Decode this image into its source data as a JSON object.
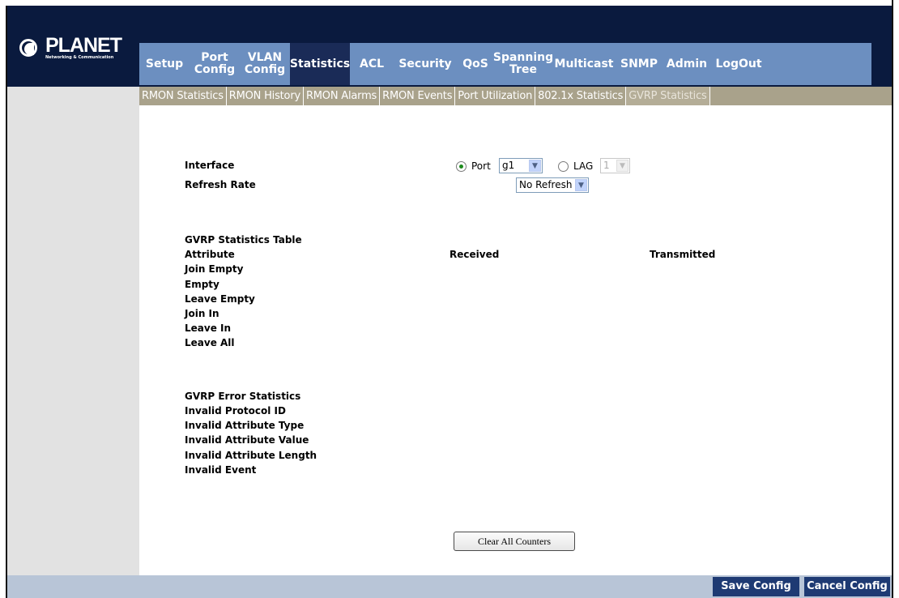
{
  "brand": {
    "logo_text": "PLANET",
    "logo_sub": "Networking & Communication"
  },
  "nav": [
    {
      "label": "Setup"
    },
    {
      "label": "Port Config"
    },
    {
      "label": "VLAN Config"
    },
    {
      "label": "Statistics",
      "active": true
    },
    {
      "label": "ACL"
    },
    {
      "label": "Security"
    },
    {
      "label": "QoS"
    },
    {
      "label": "Spanning Tree"
    },
    {
      "label": "Multicast"
    },
    {
      "label": "SNMP"
    },
    {
      "label": "Admin"
    },
    {
      "label": "LogOut"
    }
  ],
  "subnav": [
    {
      "label": "RMON Statistics"
    },
    {
      "label": "RMON History"
    },
    {
      "label": "RMON Alarms"
    },
    {
      "label": "RMON Events"
    },
    {
      "label": "Port Utilization"
    },
    {
      "label": "802.1x Statistics"
    },
    {
      "label": "GVRP Statistics",
      "active": true
    }
  ],
  "form": {
    "interface_label": "Interface",
    "refresh_label": "Refresh Rate",
    "port_radio_label": "Port",
    "port_value": "g1",
    "lag_radio_label": "LAG",
    "lag_value": "1",
    "refresh_value": "No Refresh"
  },
  "gvrp_table": {
    "title": "GVRP Statistics Table",
    "col_attribute": "Attribute",
    "col_received": "Received",
    "col_transmitted": "Transmitted",
    "rows": [
      "Join Empty",
      "Empty",
      "Leave Empty",
      "Join In",
      "Leave In",
      "Leave All"
    ]
  },
  "gvrp_errors": {
    "title": "GVRP Error Statistics",
    "rows": [
      "Invalid Protocol ID",
      "Invalid Attribute Type",
      "Invalid Attribute Value",
      "Invalid Attribute Length",
      "Invalid Event"
    ]
  },
  "actions": {
    "clear_label": "Clear All Counters",
    "save_label": "Save Config",
    "cancel_label": "Cancel Config"
  },
  "colors": {
    "header_bg": "#0a1a3e",
    "nav_bg": "#6c8fc0",
    "nav_active": "#1a2b57",
    "subnav_bg": "#a9a28b",
    "footer_btn": "#1e3a73"
  }
}
